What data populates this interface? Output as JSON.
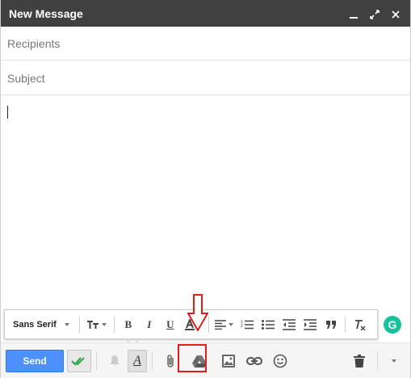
{
  "window": {
    "title": "New Message",
    "controls": [
      "minimize-icon",
      "expand-icon",
      "close-icon"
    ]
  },
  "fields": {
    "recipients_placeholder": "Recipients",
    "subject_placeholder": "Subject"
  },
  "formatting": {
    "font_label": "Sans Serif",
    "bold_label": "B",
    "italic_label": "I",
    "underline_label": "U"
  },
  "grammarly": {
    "label": "G"
  },
  "bottom": {
    "send_label": "Send",
    "format_toggle_label": "A"
  },
  "colors": {
    "titlebar": "#404040",
    "send": "#4d90fe",
    "highlight": "#e21b1b",
    "grammarly": "#15c39a"
  }
}
